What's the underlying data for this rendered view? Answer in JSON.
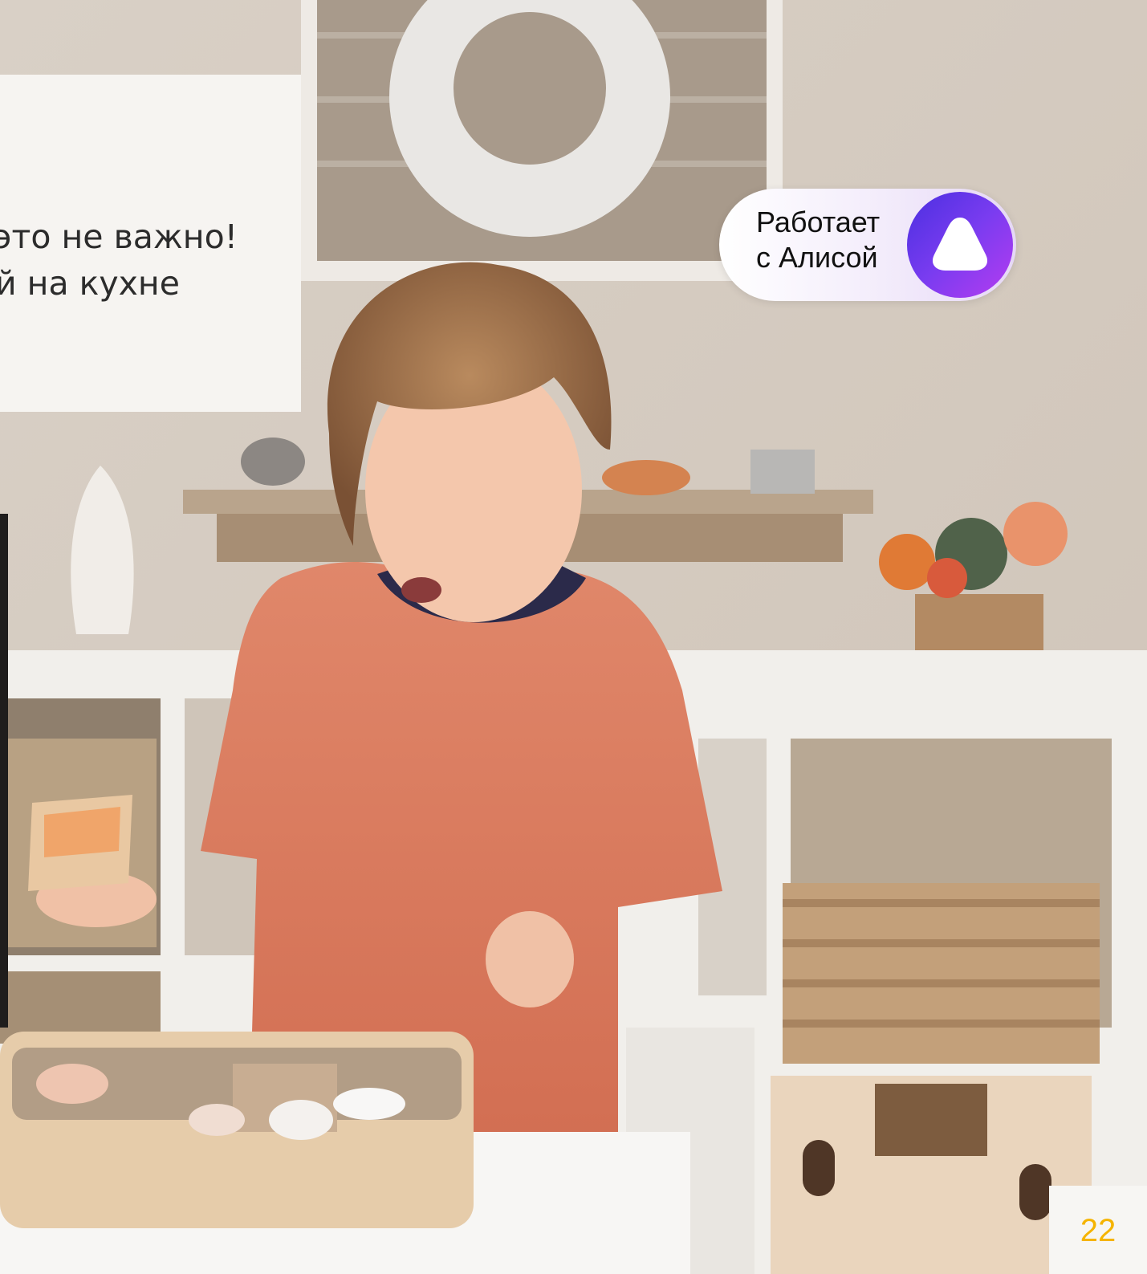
{
  "text_card": {
    "line1": "это не важно!",
    "line2": "й на кухне"
  },
  "alice_badge": {
    "line1": "Работает",
    "line2": "с Алисой",
    "logo_colors": [
      "#7a3cf0",
      "#b53cf0",
      "#4a2fe0"
    ],
    "icon": "alice-triangle-icon"
  },
  "page": {
    "number": "22",
    "number_color": "#f5b400"
  }
}
